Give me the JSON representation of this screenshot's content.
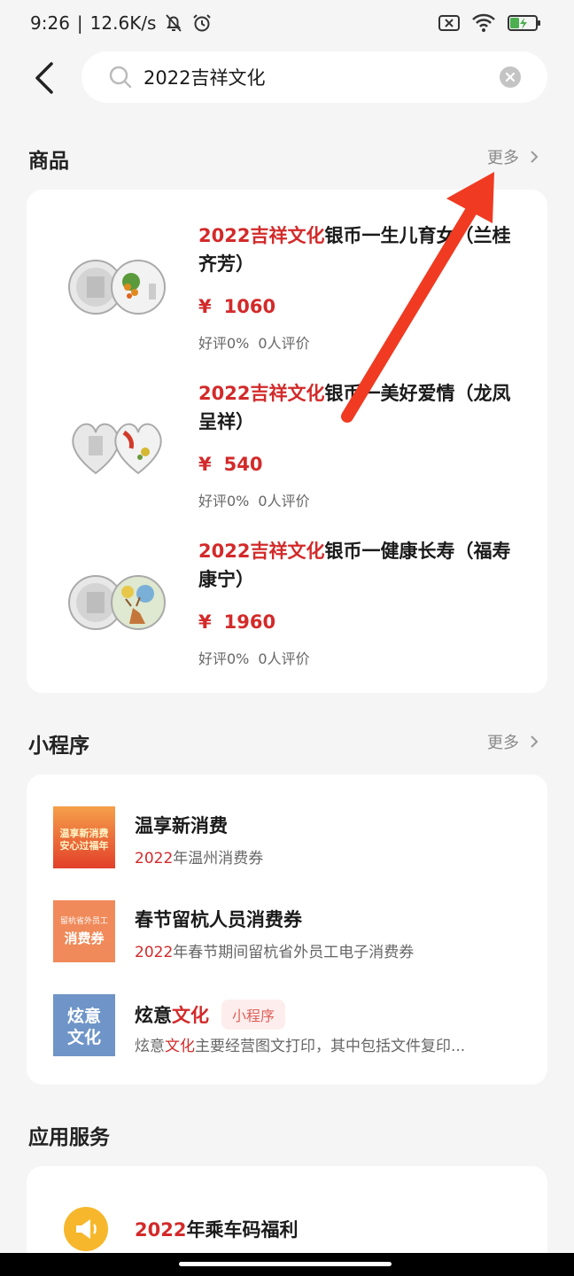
{
  "status": {
    "time": "9:26",
    "speed": "12.6K/s"
  },
  "search": {
    "query": "2022吉祥文化"
  },
  "products_section": {
    "title": "商品",
    "more": "更多",
    "items": [
      {
        "highlight": "2022吉祥文化",
        "rest": "银币一生儿育女（兰桂齐芳）",
        "currency": "¥",
        "price": "1060",
        "rating": "好评0%",
        "reviews": "0人评价"
      },
      {
        "highlight": "2022吉祥文化",
        "rest": "银币一美好爱情（龙凤呈祥）",
        "currency": "¥",
        "price": "540",
        "rating": "好评0%",
        "reviews": "0人评价"
      },
      {
        "highlight": "2022吉祥文化",
        "rest": "银币一健康长寿（福寿康宁）",
        "currency": "¥",
        "price": "1960",
        "rating": "好评0%",
        "reviews": "0人评价"
      }
    ]
  },
  "miniprograms_section": {
    "title": "小程序",
    "more": "更多",
    "items": [
      {
        "title": "温享新消费",
        "desc_highlight": "2022",
        "desc_rest": "年温州消费券",
        "img_text_1": "温享新消费",
        "img_text_2": "安心过福年"
      },
      {
        "title": "春节留杭人员消费券",
        "desc_highlight": "2022",
        "desc_rest": "年春节期间留杭省外员工电子消费券",
        "img_text_1": "留杭省外员工",
        "img_text_2": "消费券"
      },
      {
        "title_pre": "炫意",
        "title_highlight": "文化",
        "tag": "小程序",
        "desc_pre": "炫意",
        "desc_highlight": "文化",
        "desc_rest": "主要经营图文打印，其中包括文件复印...",
        "img_text_1": "炫意",
        "img_text_2": "文化"
      }
    ]
  },
  "services_section": {
    "title": "应用服务",
    "items": [
      {
        "title_highlight": "2022",
        "title_rest": "年乘车码福利"
      }
    ]
  },
  "colors": {
    "highlight": "#d32a2a",
    "background": "#f5f5f5",
    "arrow": "#f03a22"
  }
}
